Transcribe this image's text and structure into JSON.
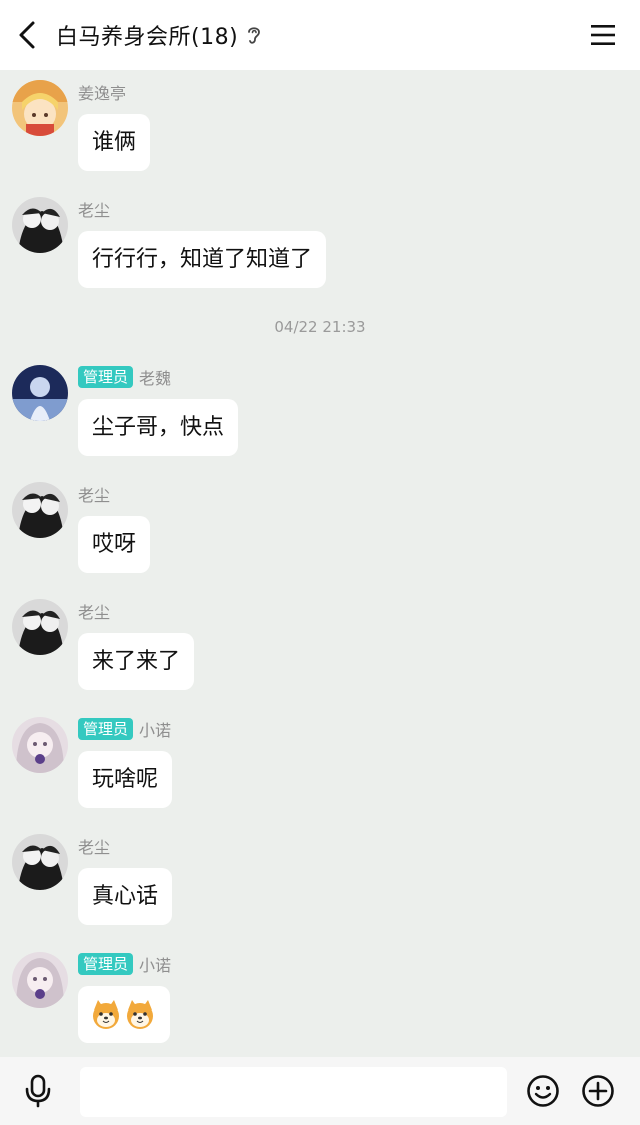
{
  "header": {
    "title": "白马养身会所(18)"
  },
  "chat": {
    "messages": [
      {
        "sender": "姜逸亭",
        "badge": "",
        "text": "谁俩"
      },
      {
        "sender": "老尘",
        "badge": "",
        "text": "行行行，知道了知道了"
      },
      {
        "sender": "老魏",
        "badge": "管理员",
        "text": "尘子哥，快点"
      },
      {
        "sender": "老尘",
        "badge": "",
        "text": "哎呀"
      },
      {
        "sender": "老尘",
        "badge": "",
        "text": "来了来了"
      },
      {
        "sender": "小诺",
        "badge": "管理员",
        "text": "玩啥呢"
      },
      {
        "sender": "老尘",
        "badge": "",
        "text": "真心话"
      },
      {
        "sender": "小诺",
        "badge": "管理员",
        "text": ""
      }
    ],
    "timestamp": "04/22 21:33",
    "sticker_emojis": "shiba-dog-emoji-x2"
  },
  "input_bar": {
    "placeholder": "",
    "value": ""
  },
  "colors": {
    "chat_background": "#ecefec",
    "bubble": "#ffffff",
    "admin_badge": "#34c9c0",
    "header_background": "#ffffff"
  }
}
